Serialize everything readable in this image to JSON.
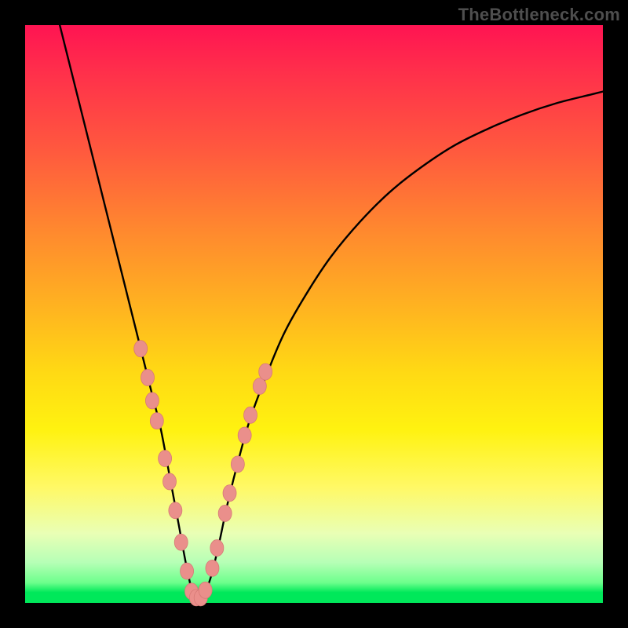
{
  "watermark": {
    "text": "TheBottleneck.com"
  },
  "colors": {
    "curve": "#000000",
    "marker_fill": "#ea8f8b",
    "marker_stroke": "#d77a76",
    "green_line": "#00e85a"
  },
  "chart_data": {
    "type": "line",
    "title": "",
    "xlabel": "",
    "ylabel": "",
    "xlim": [
      0,
      100
    ],
    "ylim": [
      0,
      100
    ],
    "grid": false,
    "series": [
      {
        "name": "bottleneck-curve",
        "comment": "V-shaped curve; y is percentage height from bottom (0) to top (100)",
        "x": [
          6,
          8,
          10,
          12,
          14,
          16,
          18,
          20,
          22,
          23.5,
          25,
          26.5,
          28,
          29.3,
          30.5,
          32,
          33.5,
          35,
          37,
          39,
          42,
          45,
          49,
          53,
          58,
          63,
          68,
          74,
          80,
          86,
          92,
          98,
          100
        ],
        "y": [
          100,
          92,
          84,
          76,
          68,
          60,
          52,
          44,
          36,
          30,
          22,
          14,
          6,
          0.8,
          0.8,
          4,
          10,
          17,
          25,
          32,
          40,
          47,
          54,
          60,
          66,
          71,
          75,
          79,
          82,
          84.5,
          86.5,
          88,
          88.5
        ]
      }
    ],
    "markers": {
      "name": "highlighted-points",
      "comment": "Salmon dots clustered near the valley on both arms",
      "points": [
        {
          "x": 20.0,
          "y": 44.0
        },
        {
          "x": 21.2,
          "y": 39.0
        },
        {
          "x": 22.0,
          "y": 35.0
        },
        {
          "x": 22.8,
          "y": 31.5
        },
        {
          "x": 24.2,
          "y": 25.0
        },
        {
          "x": 25.0,
          "y": 21.0
        },
        {
          "x": 26.0,
          "y": 16.0
        },
        {
          "x": 27.0,
          "y": 10.5
        },
        {
          "x": 28.0,
          "y": 5.5
        },
        {
          "x": 28.8,
          "y": 2.0
        },
        {
          "x": 29.6,
          "y": 0.9
        },
        {
          "x": 30.4,
          "y": 0.9
        },
        {
          "x": 31.2,
          "y": 2.2
        },
        {
          "x": 32.4,
          "y": 6.0
        },
        {
          "x": 33.2,
          "y": 9.5
        },
        {
          "x": 34.6,
          "y": 15.5
        },
        {
          "x": 35.4,
          "y": 19.0
        },
        {
          "x": 36.8,
          "y": 24.0
        },
        {
          "x": 38.0,
          "y": 29.0
        },
        {
          "x": 39.0,
          "y": 32.5
        },
        {
          "x": 40.6,
          "y": 37.5
        },
        {
          "x": 41.6,
          "y": 40.0
        }
      ]
    }
  }
}
